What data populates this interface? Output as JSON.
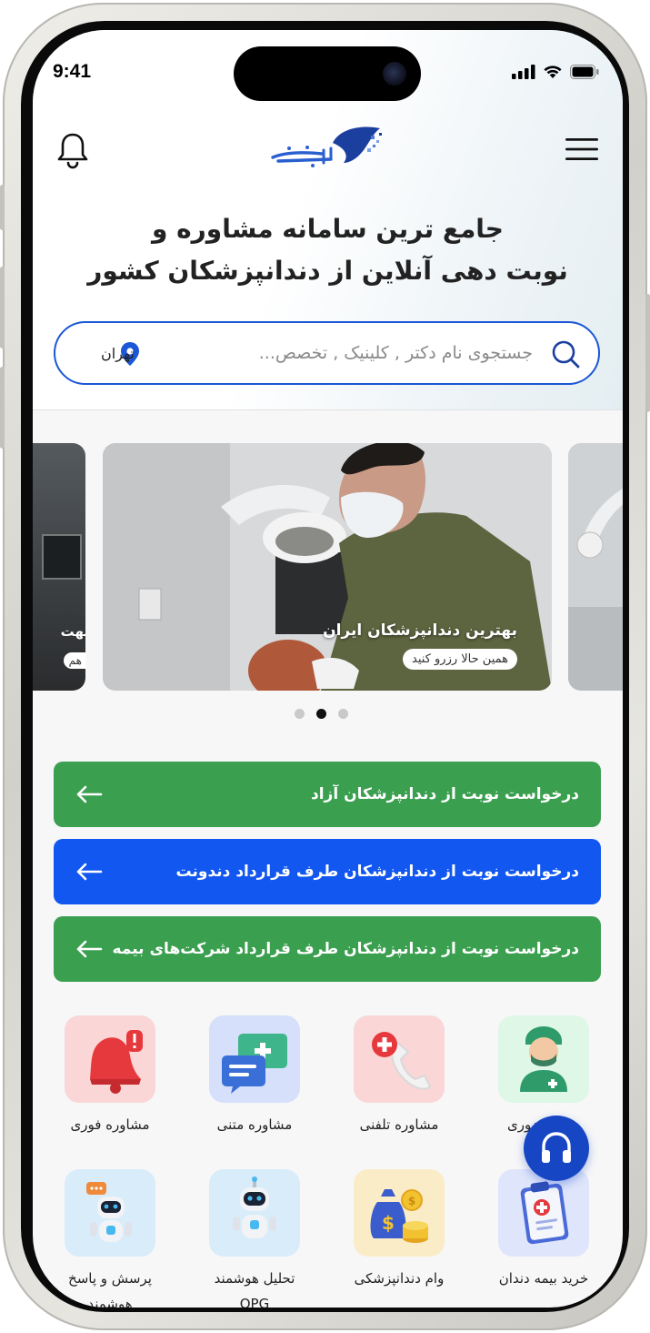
{
  "status_bar": {
    "time": "9:41"
  },
  "header": {
    "title_line1": "جامع ترین سامانه مشاوره و",
    "title_line2": "نوبت دهی آنلاین از دندانپزشکان کشور"
  },
  "search": {
    "placeholder": "جستجوی نام دکتر , کلینیک , تخصص...",
    "location": "تهران"
  },
  "carousel": {
    "slide_title": "بهترین دندانپزشکان ایران",
    "slide_button": "همین حالا رزرو کنید",
    "peek_title": "بهت",
    "peek_button": "هم",
    "active_index": 1
  },
  "actions": [
    {
      "label": "درخواست نوبت از دندانپزشکان آزاد",
      "color": "#3a9f4f"
    },
    {
      "label": "درخواست نوبت از دندانپزشکان طرف قرارداد دندونت",
      "color": "#1157f0"
    },
    {
      "label": "درخواست نوبت از دندانپزشکان طرف قرارداد شرکت‌های بیمه",
      "color": "#3a9f4f"
    }
  ],
  "services": [
    {
      "label": "مشاوره فوری",
      "icon": "alarm-bell-icon",
      "bg": "#fad6d6"
    },
    {
      "label": "مشاوره متنی",
      "icon": "chat-bubbles-icon",
      "bg": "#d6e0fa"
    },
    {
      "label": "مشاوره تلفنی",
      "icon": "phone-icon",
      "bg": "#fad6d6"
    },
    {
      "label": "وبت حضوری",
      "icon": "dentist-icon",
      "bg": "#dff7e6"
    },
    {
      "label": "پرسش و پاسخ",
      "label2": "هوشمند",
      "icon": "robot-chat-icon",
      "bg": "#d9ecfa"
    },
    {
      "label": "تحلیل هوشمند",
      "label2": "OPG",
      "icon": "robot-icon",
      "bg": "#d9ecfa"
    },
    {
      "label": "وام دندانپزشکی",
      "icon": "money-bag-icon",
      "bg": "#fbecc8"
    },
    {
      "label": "خرید بیمه دندان",
      "icon": "insurance-clipboard-icon",
      "bg": "#dfe5fb"
    }
  ],
  "colors": {
    "primary_blue": "#1b57d6",
    "green": "#3a9f4f",
    "blue_button": "#1157f0",
    "support_fab": "#1746c4"
  }
}
